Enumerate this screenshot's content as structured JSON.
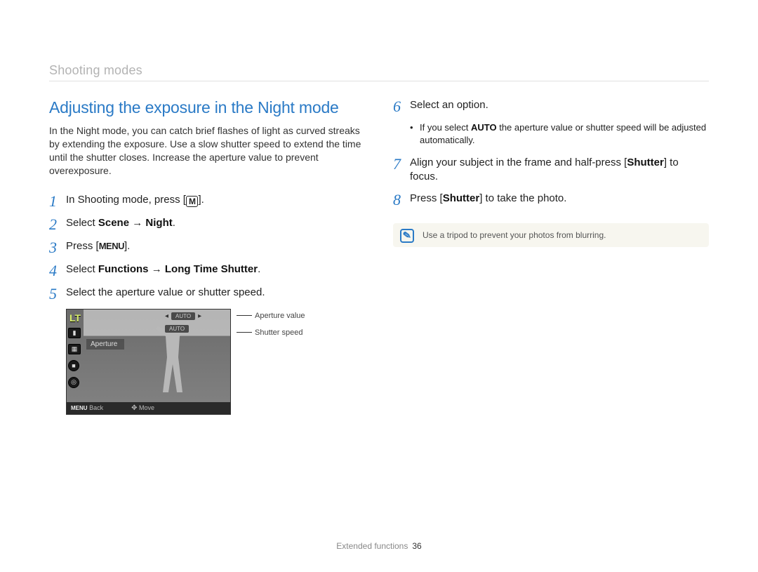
{
  "breadcrumb": "Shooting modes",
  "heading": "Adjusting the exposure in the Night mode",
  "intro": "In the Night mode, you can catch brief flashes of light as curved streaks by extending the exposure. Use a slow shutter speed to extend the time until the shutter closes. Increase the aperture value to prevent overexposure.",
  "steps_left": {
    "s1_a": "In Shooting mode, press [",
    "s1_icon": "M",
    "s1_b": "].",
    "s2_a": "Select ",
    "s2_b": "Scene",
    "s2_c": " → ",
    "s2_d": "Night",
    "s2_e": ".",
    "s3_a": "Press [",
    "s3_icon": "MENU",
    "s3_b": "].",
    "s4_a": "Select ",
    "s4_b": "Functions",
    "s4_c": " → ",
    "s4_d": "Long Time Shutter",
    "s4_e": ".",
    "s5": "Select the aperture value or shutter speed."
  },
  "lcd": {
    "lt": "LT",
    "auto1": "AUTO",
    "auto2": "AUTO",
    "label": "Aperture",
    "back_icon": "MENU",
    "back": "Back",
    "move_icon": "✥",
    "move": "Move"
  },
  "callouts": {
    "c1": "Aperture value",
    "c2": "Shutter speed"
  },
  "steps_right": {
    "s6": "Select an option.",
    "s6_sub_a": "If you select ",
    "s6_sub_b": "AUTO",
    "s6_sub_c": " the aperture value or shutter speed will be adjusted automatically.",
    "s7_a": "Align your subject in the frame and half-press [",
    "s7_b": "Shutter",
    "s7_c": "] to focus.",
    "s8_a": "Press [",
    "s8_b": "Shutter",
    "s8_c": "] to take the photo."
  },
  "tip": "Use a tripod to prevent your photos from blurring.",
  "footer": {
    "section": "Extended functions",
    "page": "36"
  },
  "step_numbers": {
    "n1": "1",
    "n2": "2",
    "n3": "3",
    "n4": "4",
    "n5": "5",
    "n6": "6",
    "n7": "7",
    "n8": "8"
  }
}
